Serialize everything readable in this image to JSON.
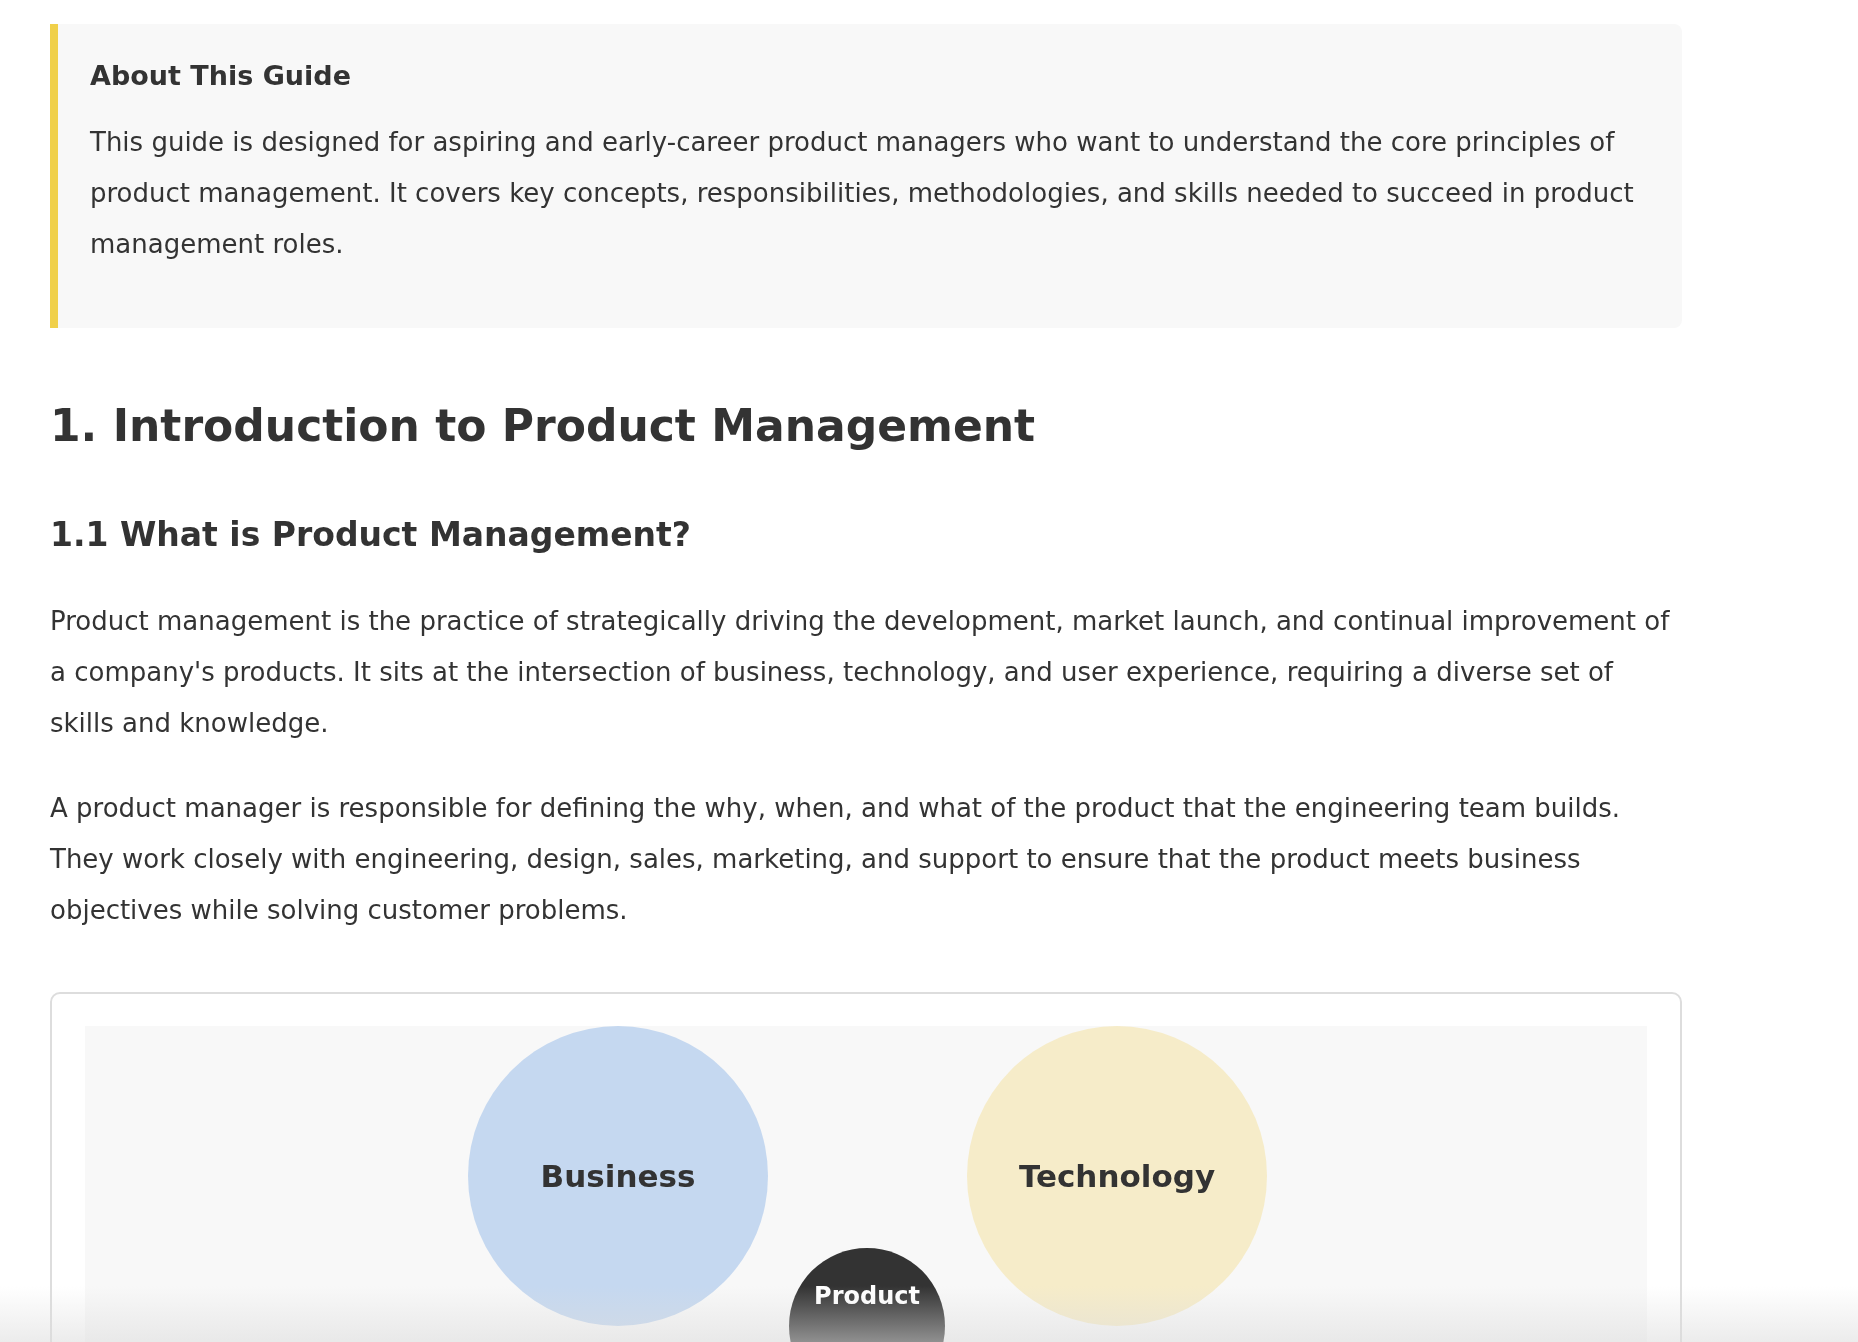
{
  "callout": {
    "title": "About This Guide",
    "text": "This guide is designed for aspiring and early-career product managers who want to understand the core principles of product management. It covers key concepts, responsibilities, methodologies, and skills needed to succeed in product management roles."
  },
  "heading": "1. Introduction to Product Management",
  "subheading": "1.1 What is Product Management?",
  "paragraphs": [
    "Product management is the practice of strategically driving the development, market launch, and continual improvement of a company's products. It sits at the intersection of business, technology, and user experience, requiring a diverse set of skills and knowledge.",
    "A product manager is responsible for defining the why, when, and what of the product that the engineering team builds. They work closely with engineering, design, sales, marketing, and support to ensure that the product meets business objectives while solving customer problems."
  ],
  "diagram": {
    "nodes": [
      {
        "label": "Business",
        "kind": "area",
        "color": "#c5d8f0"
      },
      {
        "label": "Technology",
        "kind": "area",
        "color": "#f6ecc9"
      },
      {
        "label": "Product",
        "kind": "center",
        "color": "#333333"
      }
    ]
  }
}
